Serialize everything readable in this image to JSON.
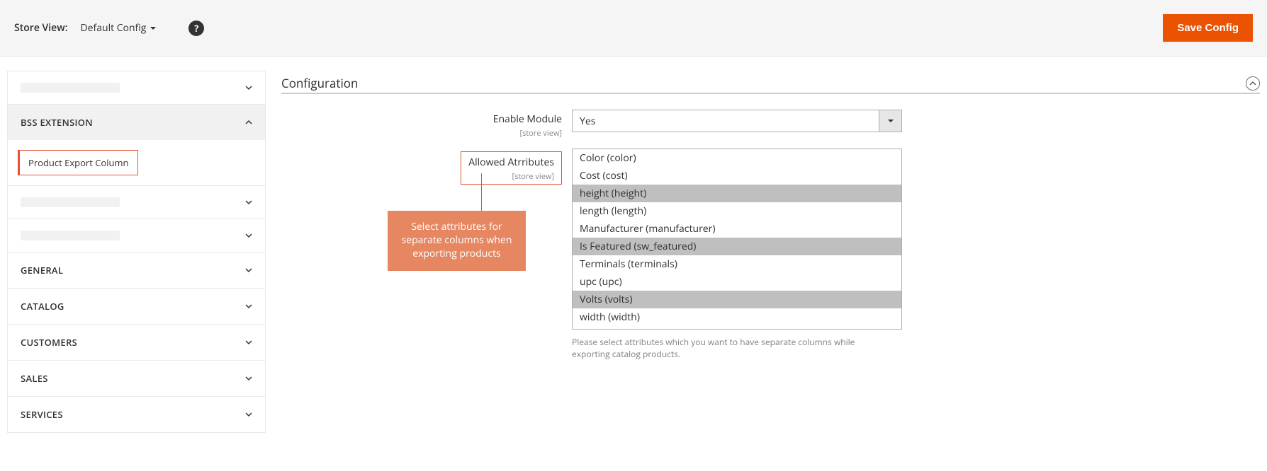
{
  "topbar": {
    "scope_label": "Store View:",
    "scope_value": "Default Config",
    "save_button": "Save Config"
  },
  "sidebar": {
    "groups": [
      {
        "label": "",
        "blurred": true,
        "expanded": false,
        "shaded": false
      },
      {
        "label": "BSS EXTENSION",
        "blurred": false,
        "expanded": true,
        "shaded": true,
        "children": [
          {
            "label": "Product Export Column"
          }
        ]
      },
      {
        "label": "",
        "blurred": true,
        "expanded": false,
        "shaded": false
      },
      {
        "label": "",
        "blurred": true,
        "expanded": false,
        "shaded": false
      },
      {
        "label": "GENERAL",
        "blurred": false,
        "expanded": false,
        "shaded": false
      },
      {
        "label": "CATALOG",
        "blurred": false,
        "expanded": false,
        "shaded": false
      },
      {
        "label": "CUSTOMERS",
        "blurred": false,
        "expanded": false,
        "shaded": false
      },
      {
        "label": "SALES",
        "blurred": false,
        "expanded": false,
        "shaded": false
      },
      {
        "label": "SERVICES",
        "blurred": false,
        "expanded": false,
        "shaded": false
      }
    ]
  },
  "config": {
    "section_title": "Configuration",
    "fields": {
      "enable": {
        "label": "Enable Module",
        "scope": "[store view]",
        "value": "Yes"
      },
      "allowed": {
        "label": "Allowed Atrributes",
        "scope": "[store view]",
        "options": [
          {
            "text": "Color (color)",
            "selected": false
          },
          {
            "text": "Cost (cost)",
            "selected": false
          },
          {
            "text": "height (height)",
            "selected": true
          },
          {
            "text": "length (length)",
            "selected": false
          },
          {
            "text": "Manufacturer (manufacturer)",
            "selected": false
          },
          {
            "text": "Is Featured (sw_featured)",
            "selected": true
          },
          {
            "text": "Terminals (terminals)",
            "selected": false
          },
          {
            "text": "upc (upc)",
            "selected": false
          },
          {
            "text": "Volts (volts)",
            "selected": true
          },
          {
            "text": "width (width)",
            "selected": false
          }
        ],
        "note": "Please select attributes which you want to have separate columns while exporting catalog products."
      }
    },
    "callout": "Select attributes for separate columns when exporting products"
  }
}
